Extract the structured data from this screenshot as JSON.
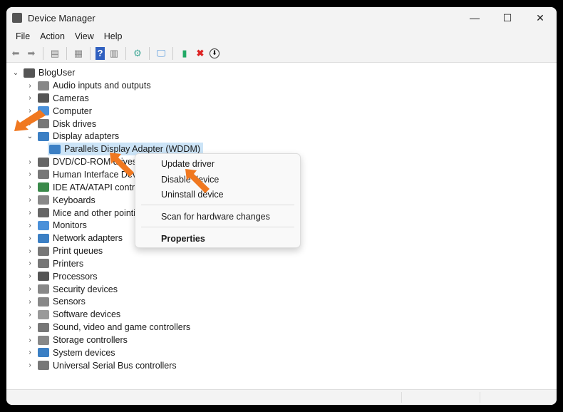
{
  "window": {
    "title": "Device Manager",
    "minimize": "—",
    "maximize": "☐",
    "close": "✕"
  },
  "menu": [
    "File",
    "Action",
    "View",
    "Help"
  ],
  "tree": {
    "root": "BlogUser",
    "items": [
      {
        "label": "Audio inputs and outputs",
        "color": "#888"
      },
      {
        "label": "Cameras",
        "color": "#555"
      },
      {
        "label": "Computer",
        "color": "#4a90d9"
      },
      {
        "label": "Disk drives",
        "color": "#777"
      },
      {
        "label": "Display adapters",
        "color": "#3b7fc4",
        "expanded": true
      },
      {
        "label": "DVD/CD-ROM drives",
        "color": "#666"
      },
      {
        "label": "Human Interface Devices",
        "color": "#777"
      },
      {
        "label": "IDE ATA/ATAPI controllers",
        "color": "#3a8a4a"
      },
      {
        "label": "Keyboards",
        "color": "#888"
      },
      {
        "label": "Mice and other pointing devices",
        "color": "#666"
      },
      {
        "label": "Monitors",
        "color": "#4a90d9"
      },
      {
        "label": "Network adapters",
        "color": "#3b7fc4"
      },
      {
        "label": "Print queues",
        "color": "#777"
      },
      {
        "label": "Printers",
        "color": "#777"
      },
      {
        "label": "Processors",
        "color": "#555"
      },
      {
        "label": "Security devices",
        "color": "#888"
      },
      {
        "label": "Sensors",
        "color": "#888"
      },
      {
        "label": "Software devices",
        "color": "#999"
      },
      {
        "label": "Sound, video and game controllers",
        "color": "#777"
      },
      {
        "label": "Storage controllers",
        "color": "#888"
      },
      {
        "label": "System devices",
        "color": "#3b7fc4"
      },
      {
        "label": "Universal Serial Bus controllers",
        "color": "#777"
      }
    ],
    "child": "Parallels Display Adapter (WDDM)"
  },
  "context_menu": {
    "update": "Update driver",
    "disable": "Disable device",
    "uninstall": "Uninstall device",
    "scan": "Scan for hardware changes",
    "properties": "Properties"
  },
  "accent": "#f07820"
}
